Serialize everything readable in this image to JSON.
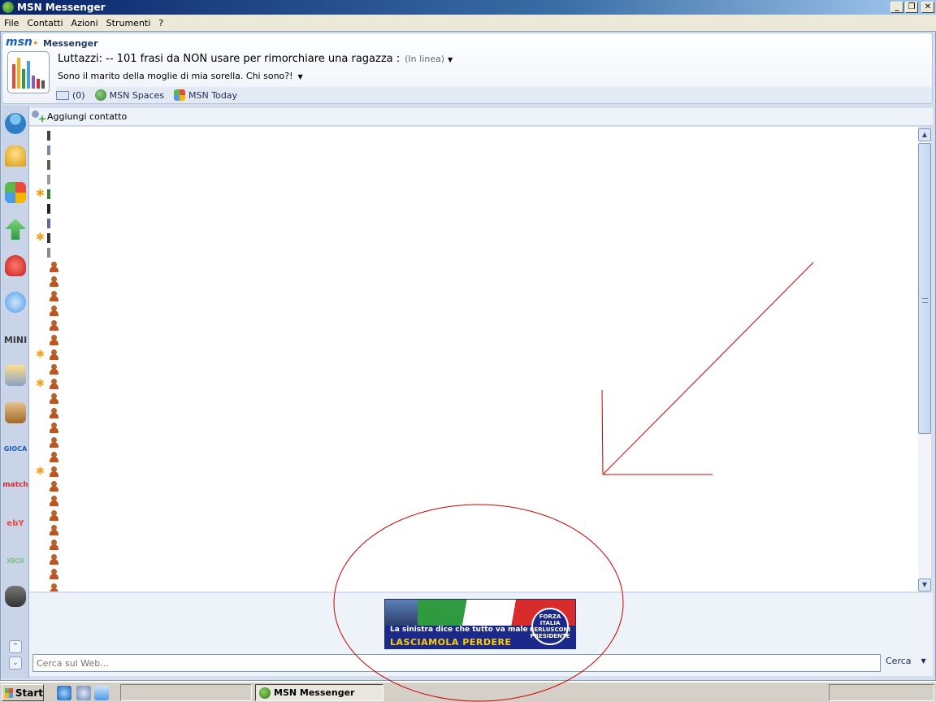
{
  "window": {
    "title": "MSN Messenger",
    "minimize": "_",
    "restore": "❐",
    "close": "✕"
  },
  "menu": [
    "File",
    "Contatti",
    "Azioni",
    "Strumenti",
    "?"
  ],
  "header": {
    "logo": "msn",
    "product": "Messenger",
    "display_name": "Luttazzi: --  101 frasi da NON usare per rimorchiare una ragazza  :",
    "status": "(In linea)",
    "personal_message": "Sono il marito della moglie di mia sorella. Chi sono?!",
    "links": {
      "mail_count": "(0)",
      "spaces": "MSN Spaces",
      "today": "MSN Today"
    }
  },
  "tabs": [
    {
      "icon": "buddy-icon",
      "color": "#2f7fc7"
    },
    {
      "icon": "bell-icon",
      "color": "#f0b020"
    },
    {
      "icon": "msn-butterfly-icon",
      "color": "#e94a3b"
    },
    {
      "icon": "green-arrow-icon",
      "color": "#2f9a3f"
    },
    {
      "icon": "heart-icon",
      "color": "#d82c2c"
    },
    {
      "icon": "airplane-icon",
      "color": "#4a9be8"
    },
    {
      "icon": "mini-label",
      "label": "MINI"
    },
    {
      "icon": "music-phone-icon",
      "color": "#f0b020"
    },
    {
      "icon": "package-icon",
      "color": "#c08040"
    },
    {
      "icon": "gioca-icon",
      "label": "GIOCA",
      "color": "#4a9be8"
    },
    {
      "icon": "match-icon",
      "label": "match",
      "color": "#d82c2c"
    },
    {
      "icon": "ebay-icon",
      "label": "ebY",
      "color": "#e94a3b"
    },
    {
      "icon": "xbox-icon",
      "label": "XBOX",
      "color": "#59b94d"
    },
    {
      "icon": "character-icon",
      "color": "#555555"
    }
  ],
  "contacts_toolbar": {
    "add_contact": "Aggiungi contatto"
  },
  "contacts": [
    {
      "kind": "thumb",
      "star": false
    },
    {
      "kind": "thumb",
      "star": false
    },
    {
      "kind": "thumb",
      "star": false
    },
    {
      "kind": "thumb",
      "star": false
    },
    {
      "kind": "thumb",
      "star": true
    },
    {
      "kind": "thumb",
      "star": false
    },
    {
      "kind": "thumb",
      "star": false
    },
    {
      "kind": "thumb",
      "star": true
    },
    {
      "kind": "thumb",
      "star": false
    },
    {
      "kind": "buddy",
      "star": false
    },
    {
      "kind": "buddy",
      "star": false
    },
    {
      "kind": "buddy",
      "star": false
    },
    {
      "kind": "buddy",
      "star": false
    },
    {
      "kind": "buddy",
      "star": false
    },
    {
      "kind": "buddy",
      "star": false
    },
    {
      "kind": "buddy",
      "star": true
    },
    {
      "kind": "buddy",
      "star": false
    },
    {
      "kind": "buddy",
      "star": true
    },
    {
      "kind": "buddy",
      "star": false
    },
    {
      "kind": "buddy",
      "star": false
    },
    {
      "kind": "buddy",
      "star": false
    },
    {
      "kind": "buddy",
      "star": false
    },
    {
      "kind": "buddy",
      "star": false
    },
    {
      "kind": "buddy",
      "star": true
    },
    {
      "kind": "buddy",
      "star": false
    },
    {
      "kind": "buddy",
      "star": false
    },
    {
      "kind": "buddy",
      "star": false
    },
    {
      "kind": "buddy",
      "star": false
    },
    {
      "kind": "buddy",
      "star": false
    },
    {
      "kind": "buddy",
      "star": false
    },
    {
      "kind": "buddy",
      "star": false
    },
    {
      "kind": "buddy",
      "star": false
    }
  ],
  "ad": {
    "line1": "La sinistra dice che tutto va male",
    "line2": "LASCIAMOLA PERDERE",
    "badge": "FORZA ITALIA BERLUSCONI PRESIDENTE"
  },
  "search": {
    "placeholder": "Cerca sul Web...",
    "button": "Cerca"
  },
  "taskbar": {
    "start": "Start",
    "active_task": "MSN Messenger"
  },
  "colors": {
    "annotation": "#cc0000",
    "title_gradient_start": "#0a246a",
    "brand": "#1a5fb4"
  }
}
